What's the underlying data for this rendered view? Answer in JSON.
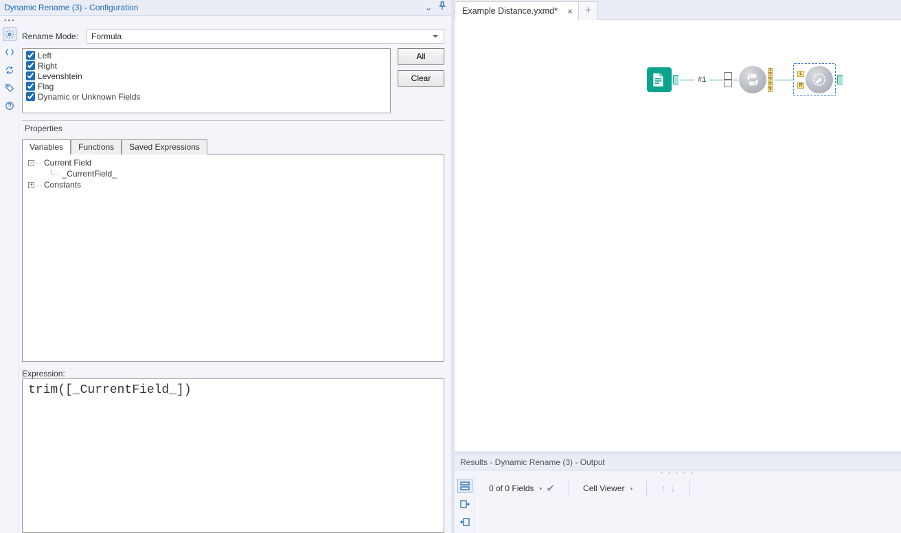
{
  "config_title": "Dynamic Rename (3) - Configuration",
  "rename_mode_label": "Rename Mode:",
  "rename_mode_value": "Formula",
  "fields": {
    "left": "Left",
    "right": "Right",
    "lev": "Levenshtein",
    "flag": "Flag",
    "dyn": "Dynamic or Unknown Fields"
  },
  "buttons": {
    "all": "All",
    "clear": "Clear"
  },
  "properties_label": "Properties",
  "tabs": {
    "variables": "Variables",
    "functions": "Functions",
    "saved": "Saved Expressions"
  },
  "tree": {
    "current_field": "Current Field",
    "current_field_var": "_CurrentField_",
    "constants": "Constants"
  },
  "expression_label": "Expression:",
  "expression_value": "trim([_CurrentField_])",
  "file_tab": "Example Distance.yxmd*",
  "workflow_label": "#1",
  "port_nums": [
    "1",
    "2",
    "3",
    "4",
    "5"
  ],
  "lr_ports": [
    "L",
    "R"
  ],
  "results_title": "Results - Dynamic Rename (3) - Output",
  "results_toolbar": {
    "fields": "0 of 0 Fields",
    "cellviewer": "Cell Viewer"
  }
}
